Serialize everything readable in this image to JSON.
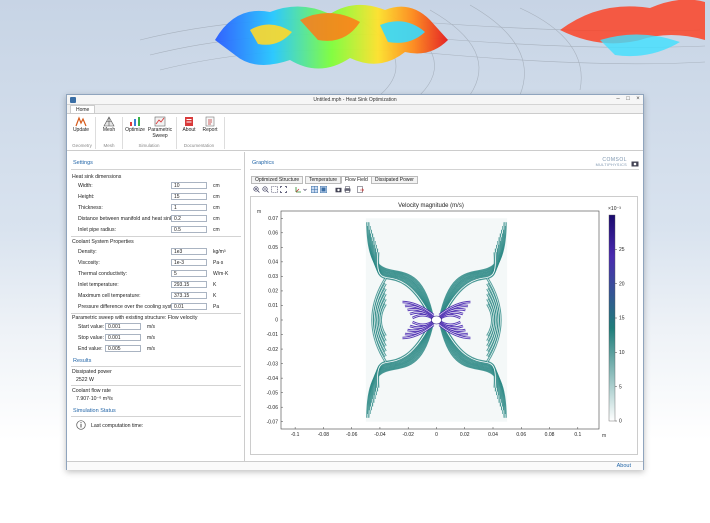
{
  "window": {
    "title": "Untitled.mph - Heat Sink Optimization"
  },
  "ribbon": {
    "tab": "Home",
    "buttons": {
      "update": "Update",
      "mesh": "Mesh",
      "optimize": "Optimize",
      "parametric_line1": "Parametric",
      "parametric_line2": "Sweep",
      "about": "About",
      "report": "Report"
    },
    "groups": {
      "geometry": "Geometry",
      "mesh": "Mesh",
      "simulation": "Simulation",
      "documentation": "Documentation"
    }
  },
  "settings": {
    "title": "Settings",
    "heat_sink": {
      "title": "Heat sink dimensions",
      "width": {
        "label": "Width:",
        "value": "10",
        "unit": "cm"
      },
      "height": {
        "label": "Height:",
        "value": "15",
        "unit": "cm"
      },
      "thickness": {
        "label": "Thickness:",
        "value": "1",
        "unit": "cm"
      },
      "distance": {
        "label": "Distance between manifold and heat sink:",
        "value": "0.2",
        "unit": "cm"
      },
      "inlet_radius": {
        "label": "Inlet pipe radius:",
        "value": "0.5",
        "unit": "cm"
      }
    },
    "coolant": {
      "title": "Coolant System Properties",
      "density": {
        "label": "Density:",
        "value": "1e3",
        "unit": "kg/m³"
      },
      "viscosity": {
        "label": "Viscosity:",
        "value": "1e-3",
        "unit": "Pa·s"
      },
      "conductivity": {
        "label": "Thermal conductivity:",
        "value": "5",
        "unit": "W/m·K"
      },
      "inlet_temp": {
        "label": "Inlet temperature:",
        "value": "293.15",
        "unit": "K"
      },
      "max_temp": {
        "label": "Maximum cell temperature:",
        "value": "373.15",
        "unit": "K"
      },
      "pressure": {
        "label": "Pressure difference over the cooling system:",
        "value": "0.01",
        "unit": "Pa"
      }
    },
    "sweep": {
      "title": "Parametric sweep with existing structure: Flow velocity",
      "start": {
        "label": "Start value:",
        "value": "0.001",
        "unit": "m/s"
      },
      "stop": {
        "label": "Stop value:",
        "value": "0.001",
        "unit": "m/s"
      },
      "end": {
        "label": "End value:",
        "value": "0.005",
        "unit": "m/s"
      }
    }
  },
  "results": {
    "title": "Results",
    "power_label": "Dissipated power",
    "power_value": "2522 W",
    "flow_label": "Coolant flow rate",
    "flow_value": "7.907·10⁻⁶ m³/s"
  },
  "status": {
    "title": "Simulation Status",
    "computation": "Last computation time:"
  },
  "graphics": {
    "title": "Graphics",
    "logo_line1": "COMSOL",
    "logo_line2": "MULTIPHYSICS",
    "tabs": [
      "Optimized Structure",
      "Temperature",
      "Flow Field",
      "Dissipated Power"
    ],
    "active_tab": 2
  },
  "chart_data": {
    "type": "heatmap",
    "title": "Velocity magnitude (m/s)",
    "x_unit": "m",
    "y_unit": "m",
    "x_ticks": [
      "-0.1",
      "-0.08",
      "-0.06",
      "-0.04",
      "-0.02",
      "0",
      "0.02",
      "0.04",
      "0.06",
      "0.08",
      "0.1"
    ],
    "y_ticks": [
      "0.07",
      "0.06",
      "0.05",
      "0.04",
      "0.03",
      "0.02",
      "0.01",
      "0",
      "-0.01",
      "-0.02",
      "-0.03",
      "-0.04",
      "-0.05",
      "-0.06",
      "-0.07"
    ],
    "xlim": [
      -0.11,
      0.115
    ],
    "ylim": [
      -0.075,
      0.075
    ],
    "colorbar": {
      "exponent": "×10⁻³",
      "ticks": [
        "25",
        "20",
        "15",
        "10",
        "5",
        "0"
      ],
      "range": [
        0,
        30
      ],
      "colors": [
        "#ffffff",
        "#1f7d7a",
        "#4a2ab0",
        "#1a0a6e"
      ]
    }
  },
  "footer": {
    "about": "About"
  }
}
